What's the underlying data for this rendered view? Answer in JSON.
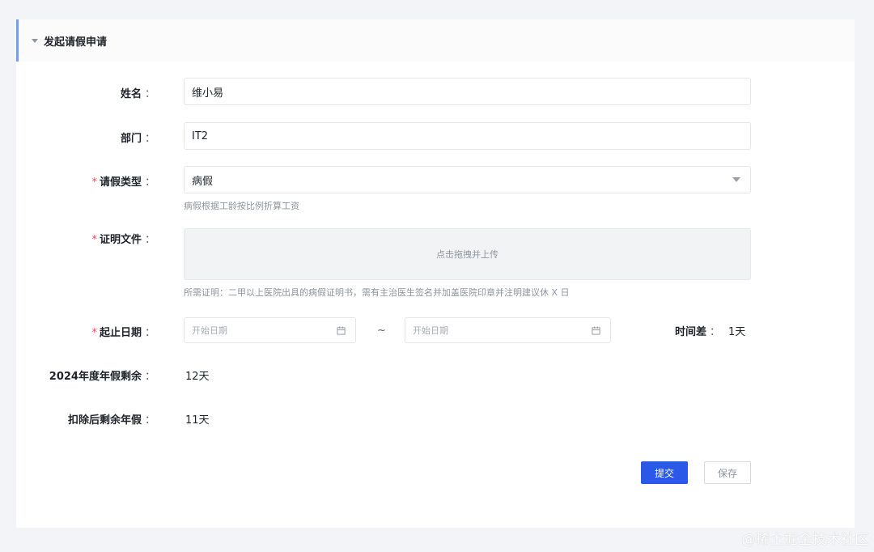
{
  "header": {
    "title": "发起请假申请",
    "collapse_icon": "caret-down-icon"
  },
  "form": {
    "name": {
      "label": "姓名",
      "value": "维小易"
    },
    "department": {
      "label": "部门",
      "value": "IT2"
    },
    "leave_type": {
      "label": "请假类型",
      "required": "*",
      "selected": "病假",
      "hint": "病假根据工龄按比例折算工资"
    },
    "proof": {
      "label": "证明文件",
      "required": "*",
      "upload_text": "点击拖拽并上传",
      "hint": "所需证明：二甲以上医院出具的病假证明书，需有主治医生签名并加盖医院印章并注明建议休 X 日"
    },
    "date_range": {
      "label": "起止日期",
      "required": "*",
      "start_placeholder": "开始日期",
      "end_placeholder": "开始日期",
      "separator": "~",
      "icon": "calendar-icon"
    },
    "duration": {
      "label": "时间差",
      "value": "1天"
    },
    "annual_remaining": {
      "label": "2024年度年假剩余",
      "value": "12天"
    },
    "after_deduct": {
      "label": "扣除后剩余年假",
      "value": "11天"
    },
    "colon": "："
  },
  "actions": {
    "submit": "提交",
    "save": "保存"
  },
  "watermark": "@稀土掘金技术社区",
  "colors": {
    "primary": "#2b58e6",
    "required": "#e34d59",
    "accent_bar": "#7d9ddf"
  }
}
